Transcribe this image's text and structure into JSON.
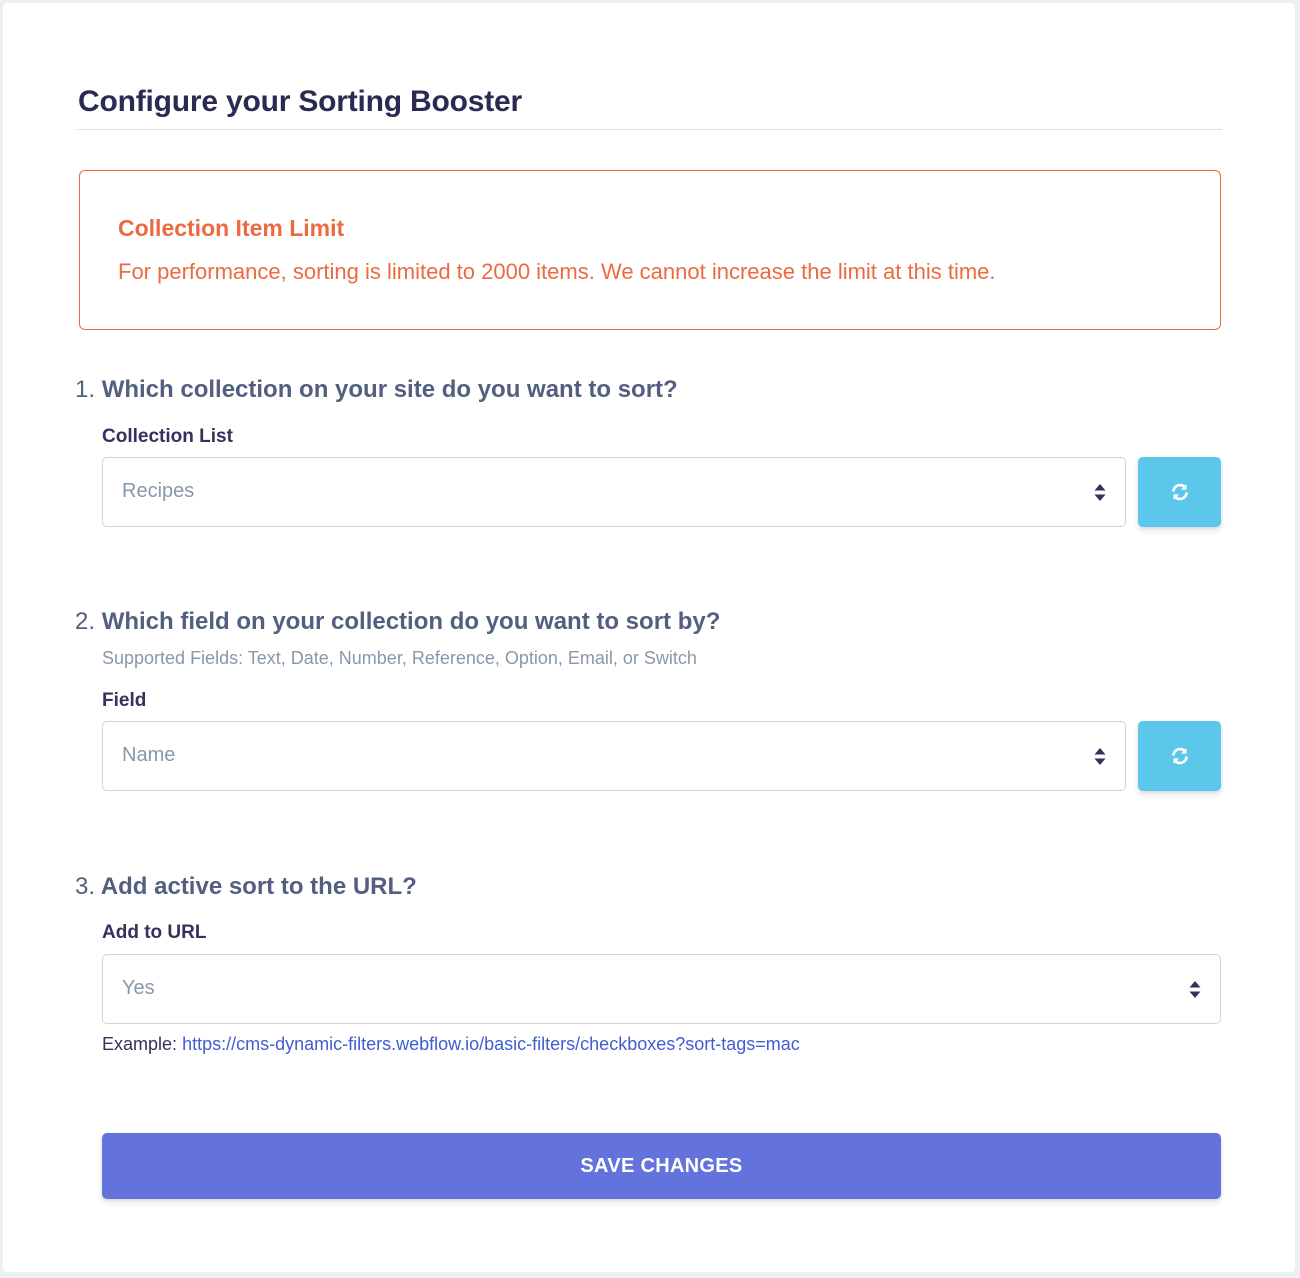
{
  "page": {
    "title": "Configure your Sorting Booster"
  },
  "alert": {
    "title": "Collection Item Limit",
    "text": "For performance, sorting is limited to 2000 items. We cannot increase the limit at this time.",
    "color": "#ec6a40"
  },
  "sections": [
    {
      "number": "1.",
      "question": "Which collection on your site do you want to sort?",
      "label": "Collection List",
      "value": "Recipes",
      "refresh_icon": "refresh-icon"
    },
    {
      "number": "2.",
      "question": "Which field on your collection do you want to sort by?",
      "hint": "Supported Fields: Text, Date, Number, Reference, Option, Email, or Switch",
      "label": "Field",
      "value": "Name",
      "refresh_icon": "refresh-icon"
    },
    {
      "number": "3.",
      "question": "Add active sort to the URL?",
      "label": "Add to URL",
      "value": "Yes"
    }
  ],
  "example": {
    "prefix": "Example:",
    "link": "https://cms-dynamic-filters.webflow.io/basic-filters/checkboxes?sort-tags=mac"
  },
  "save_button": {
    "label": "SAVE CHANGES",
    "color": "#6373db"
  },
  "colors": {
    "refresh_button": "#5bc7ea",
    "link": "#3f5dd1"
  }
}
